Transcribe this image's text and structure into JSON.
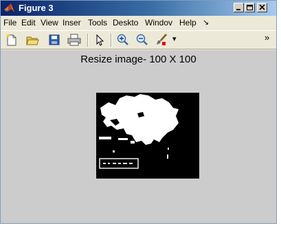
{
  "window": {
    "title": "Figure 3"
  },
  "titlebar": {
    "minimize_glyph": "_",
    "maximize_glyph": "□",
    "close_glyph": "×"
  },
  "menu": {
    "items": [
      "File",
      "Edit",
      "View",
      "Inser",
      "Tools",
      "Deskto",
      "Windov",
      "Help"
    ],
    "overflow_glyph": "↘"
  },
  "toolbar": {
    "icons": [
      "new-figure-icon",
      "open-file-icon",
      "save-icon",
      "print-icon",
      "pointer-icon",
      "zoom-in-icon",
      "zoom-out-icon",
      "brush-icon"
    ],
    "dropdown_glyph": "▾",
    "more_glyph": "»"
  },
  "axes": {
    "title": "Resize  image- 100 X 100"
  },
  "colors": {
    "window_bg": "#ece9d8",
    "figure_bg": "#cccccc",
    "title_start": "#0a246a",
    "title_end": "#a6caf0",
    "image_fg": "#ffffff",
    "image_bg": "#000000"
  }
}
